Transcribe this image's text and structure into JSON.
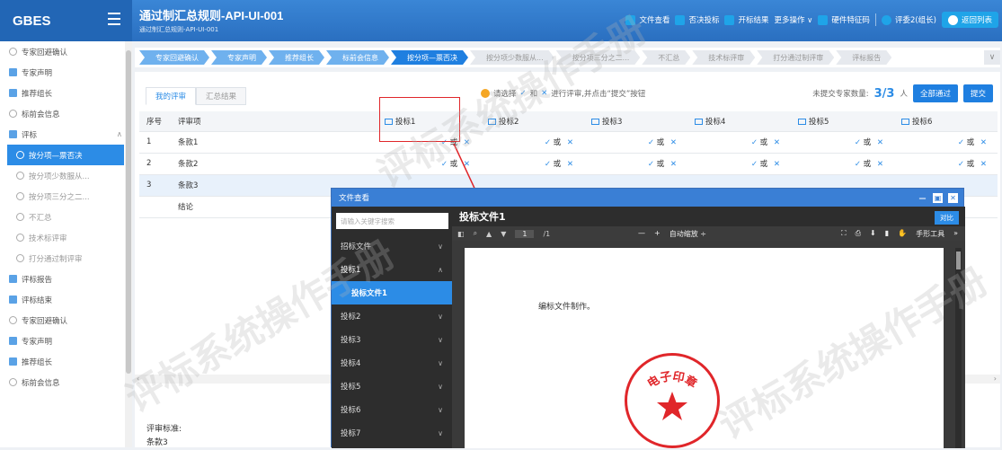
{
  "app": {
    "logo": "GBES",
    "project_title": "通过制汇总规则-API-UI-001",
    "project_subtitle": "通过制汇总规则-API-UI-001"
  },
  "header": {
    "actions": [
      {
        "label": "文件查看",
        "icon": "file-icon"
      },
      {
        "label": "否决投标",
        "icon": "reject-icon"
      },
      {
        "label": "开标结果",
        "icon": "result-icon"
      },
      {
        "label": "更多操作 ∨",
        "icon": ""
      },
      {
        "label": "硬件特征码",
        "icon": "hardware-icon"
      },
      {
        "label": "评委2(组长)",
        "icon": "user-icon"
      },
      {
        "label": "返回列表",
        "icon": "back-icon"
      }
    ]
  },
  "sidebar": {
    "items": [
      {
        "label": "专家回避确认",
        "type": "dot"
      },
      {
        "label": "专家声明",
        "type": "sq"
      },
      {
        "label": "推荐组长",
        "type": "sq"
      },
      {
        "label": "标前会信息",
        "type": "dot"
      },
      {
        "label": "评标",
        "type": "sq",
        "chev": "∧"
      },
      {
        "label": "按分项—票否决",
        "type": "active"
      },
      {
        "label": "按分项少数服从...",
        "type": "sub"
      },
      {
        "label": "按分项三分之二...",
        "type": "sub"
      },
      {
        "label": "不汇总",
        "type": "sub"
      },
      {
        "label": "技术标评审",
        "type": "sub"
      },
      {
        "label": "打分通过制评审",
        "type": "sub"
      },
      {
        "label": "评标报告",
        "type": "sq"
      },
      {
        "label": "评标结束",
        "type": "sq"
      },
      {
        "label": "专家回避确认",
        "type": "dot"
      },
      {
        "label": "专家声明",
        "type": "sq"
      },
      {
        "label": "推荐组长",
        "type": "sq"
      },
      {
        "label": "标前会信息",
        "type": "dot"
      }
    ]
  },
  "steps": [
    {
      "label": "专家回避确认",
      "state": "done"
    },
    {
      "label": "专家声明",
      "state": "done"
    },
    {
      "label": "推荐组长",
      "state": "done"
    },
    {
      "label": "标前会信息",
      "state": "done"
    },
    {
      "label": "按分项—票否决",
      "state": "active"
    },
    {
      "label": "按分项少数服从...",
      "state": "future"
    },
    {
      "label": "按分项三分之二...",
      "state": "future"
    },
    {
      "label": "不汇总",
      "state": "future"
    },
    {
      "label": "技术标评审",
      "state": "future"
    },
    {
      "label": "打分通过制评审",
      "state": "future"
    },
    {
      "label": "评标报告",
      "state": "future"
    }
  ],
  "tabs": [
    {
      "label": "我的评审"
    },
    {
      "label": "汇总结果"
    }
  ],
  "hint": {
    "pre": "请选择",
    "mid": "和",
    "post": "进行评审,并点击“提交”按钮"
  },
  "summary": {
    "label": "未提交专家数量:",
    "count": "3/3",
    "unit": "人"
  },
  "buttons": {
    "pass_all": "全部通过",
    "submit": "提交"
  },
  "table": {
    "headers": [
      "序号",
      "评审项",
      "投标1",
      "投标2",
      "投标3",
      "投标4",
      "投标5",
      "投标6"
    ],
    "rows": [
      {
        "no": "1",
        "item": "条款1",
        "cells": [
          "✓ 或 ✕",
          "✓ 或 ✕",
          "✓ 或 ✕",
          "✓ 或 ✕",
          "✓ 或 ✕",
          "✓ 或 ✕"
        ]
      },
      {
        "no": "2",
        "item": "条款2",
        "cells": [
          "✓ 或 ✕",
          "✓ 或 ✕",
          "✓ 或 ✕",
          "✓ 或 ✕",
          "✓ 或 ✕",
          "✓ 或 ✕"
        ]
      },
      {
        "no": "3",
        "item": "条款3",
        "cells": [
          "",
          "",
          "",
          "",
          "",
          ""
        ]
      },
      {
        "no": "",
        "item": "结论",
        "cells": [
          "",
          "",
          "",
          "",
          "",
          ""
        ]
      }
    ]
  },
  "criteria": {
    "label": "评审标准:",
    "value": "条款3"
  },
  "modal": {
    "title": "文件查看",
    "search_placeholder": "请输入关键字搜索",
    "doc_title": "投标文件1",
    "compare": "对比",
    "files": [
      {
        "label": "招标文件",
        "state": "collapsed",
        "chev": "∨"
      },
      {
        "label": "投标1",
        "state": "open",
        "chev": "∧"
      },
      {
        "label": "投标文件1",
        "state": "active",
        "chev": ""
      },
      {
        "label": "投标2",
        "state": "collapsed",
        "chev": "∨"
      },
      {
        "label": "投标3",
        "state": "collapsed",
        "chev": "∨"
      },
      {
        "label": "投标4",
        "state": "collapsed",
        "chev": "∨"
      },
      {
        "label": "投标5",
        "state": "collapsed",
        "chev": "∨"
      },
      {
        "label": "投标6",
        "state": "collapsed",
        "chev": "∨"
      },
      {
        "label": "投标7",
        "state": "collapsed",
        "chev": "∨"
      }
    ],
    "toolbar": {
      "page": "1",
      "total": "/1",
      "zoom": "自动缩放 ÷",
      "tools": "手形工具"
    },
    "page_text": "编标文件制作。",
    "seal_text": "电子印章"
  },
  "watermark": "评标系统操作手册"
}
